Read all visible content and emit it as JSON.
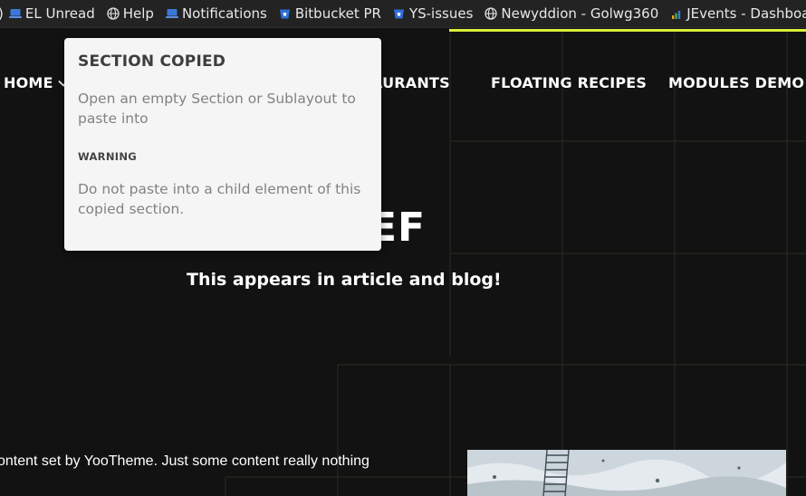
{
  "bookmarks": {
    "leading_fragment": ")",
    "items": [
      {
        "label": "EL Unread",
        "icon": "laptop-icon"
      },
      {
        "label": "Help",
        "icon": "globe-icon"
      },
      {
        "label": "Notifications",
        "icon": "laptop-icon"
      },
      {
        "label": "Bitbucket PR",
        "icon": "bitbucket-icon"
      },
      {
        "label": "YS-issues",
        "icon": "bitbucket-icon"
      },
      {
        "label": "Newyddion - Golwg360",
        "icon": "globe-icon"
      },
      {
        "label": "JEvents - Dashboa",
        "icon": "bar-chart-icon"
      }
    ]
  },
  "nav": {
    "home": "HOME",
    "restaurants": "AURANTS",
    "floating_recipes": "FLOATING RECIPES",
    "modules_demo": "MODULES DEMO"
  },
  "hero": {
    "title_fragment": "EF",
    "subtitle": "This appears in article and blog!"
  },
  "content": {
    "body_text": "ontent set by YooTheme. Just some content really nothing"
  },
  "popup": {
    "title": "SECTION COPIED",
    "message": "Open an empty Section or Sublayout to paste into",
    "warning_label": "WARNING",
    "warning_text": "Do not paste into a child element of this copied section."
  },
  "colors": {
    "background": "#121212",
    "accent": "#d9f038",
    "popup_background": "#f5f5f5",
    "bookmark_icon_blue": "#2f6fd6"
  }
}
